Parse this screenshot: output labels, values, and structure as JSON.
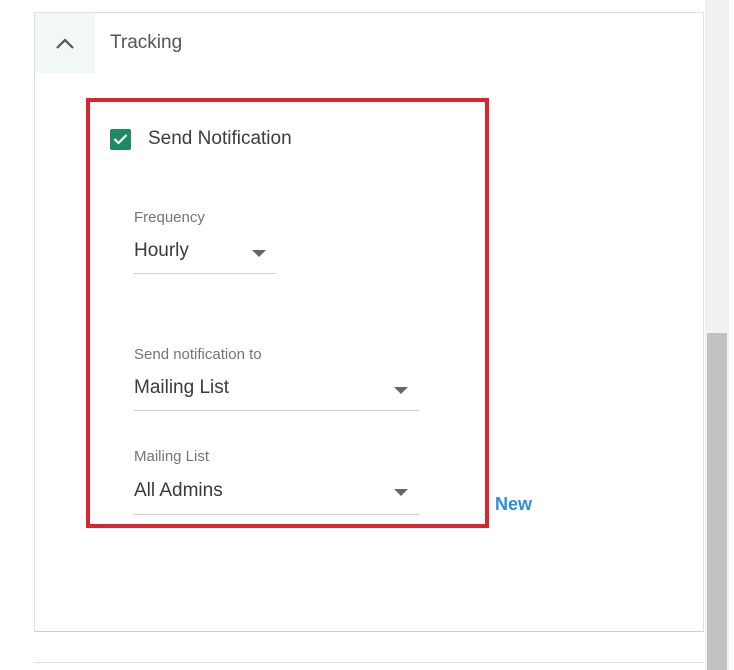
{
  "section": {
    "title": "Tracking",
    "collapse_icon": "chevron-up-icon"
  },
  "notification": {
    "checkbox_label": "Send Notification",
    "checked": true,
    "accent_color": "#1e8a60"
  },
  "frequency": {
    "label": "Frequency",
    "value": "Hourly"
  },
  "send_to": {
    "label": "Send notification to",
    "value": "Mailing List"
  },
  "mailing_list": {
    "label": "Mailing List",
    "value": "All Admins",
    "new_link": "New"
  },
  "colors": {
    "highlight_border": "#d9252b",
    "link": "#2b8ed6"
  }
}
